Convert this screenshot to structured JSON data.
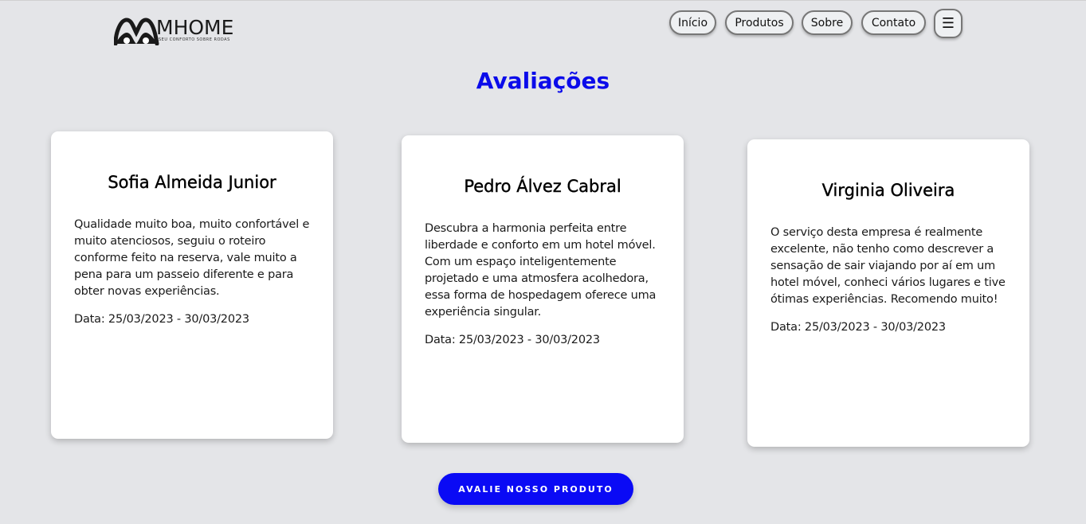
{
  "header": {
    "logo": {
      "wordmark": "MHOME",
      "tagline": "SEU CONFORTO SOBRE RODAS"
    },
    "nav": [
      {
        "label": "Início"
      },
      {
        "label": "Produtos"
      },
      {
        "label": "Sobre"
      },
      {
        "label": "Contato"
      }
    ],
    "menu_icon": "☰"
  },
  "main": {
    "title": "Avaliações",
    "reviews": [
      {
        "name": "Sofia Almeida Junior",
        "text": "Qualidade muito boa, muito confortável e muito atenciosos, seguiu o roteiro conforme feito na reserva, vale muito a pena para um passeio diferente e para obter novas experiências.",
        "date": "Data: 25/03/2023 - 30/03/2023"
      },
      {
        "name": "Pedro Álvez Cabral",
        "text": "Descubra a harmonia perfeita entre liberdade e conforto em um hotel móvel. Com um espaço inteligentemente projetado e uma atmosfera acolhedora, essa forma de hospedagem oferece uma experiência singular.",
        "date": "Data: 25/03/2023 - 30/03/2023"
      },
      {
        "name": "Virginia Oliveira",
        "text": "O serviço desta empresa é realmente excelente, não tenho como descrever a sensação de sair viajando por aí em um hotel móvel, conheci vários lugares e tive ótimas experiências. Recomendo muito!",
        "date": "Data: 25/03/2023 - 30/03/2023"
      }
    ],
    "cta_label": "AVALIE NOSSO PRODUTO"
  },
  "colors": {
    "background": "#e4e5e8",
    "accent": "#0a0af5",
    "title": "#0b0bea",
    "card": "#ffffff"
  }
}
